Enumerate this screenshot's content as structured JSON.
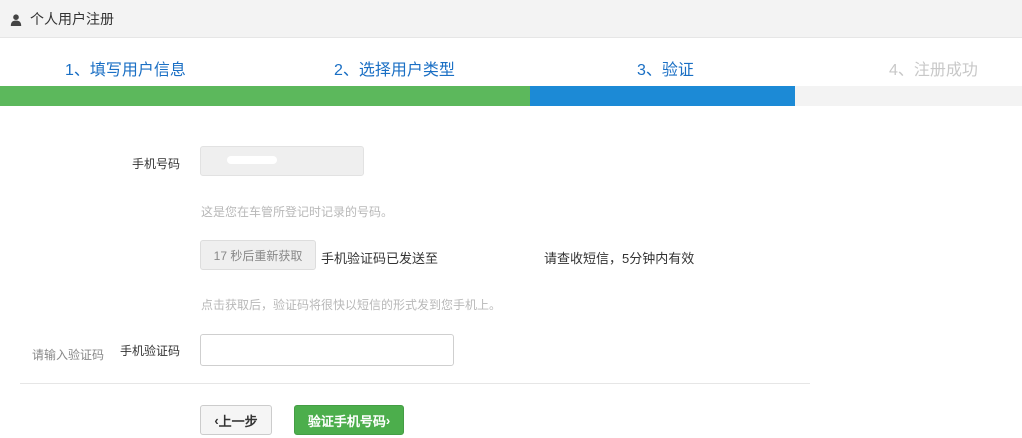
{
  "header": {
    "title": "个人用户注册",
    "icon": "user-icon"
  },
  "steps": [
    {
      "label": "1、填写用户信息",
      "state": "done"
    },
    {
      "label": "2、选择用户类型",
      "state": "done"
    },
    {
      "label": "3、验证",
      "state": "current"
    },
    {
      "label": "4、注册成功",
      "state": "pending"
    }
  ],
  "colors": {
    "done": "#5cb85c",
    "current": "#1c8ad6",
    "step_text": "#1a6fc4",
    "primary_button": "#4cae4c"
  },
  "form": {
    "phone_label": "手机号码",
    "phone_hint": "这是您在车管所登记时记录的号码。",
    "resend_button": "17 秒后重新获取",
    "sent_prefix": "手机验证码已发送至",
    "sent_suffix": "请查收短信，5分钟内有效",
    "code_hint": "点击获取后，验证码将很快以短信的形式发到您手机上。",
    "code_outer_label": "请输入验证码",
    "code_label": "手机验证码",
    "code_value": "",
    "prev_button": "上一步",
    "verify_button": "验证手机号码"
  }
}
